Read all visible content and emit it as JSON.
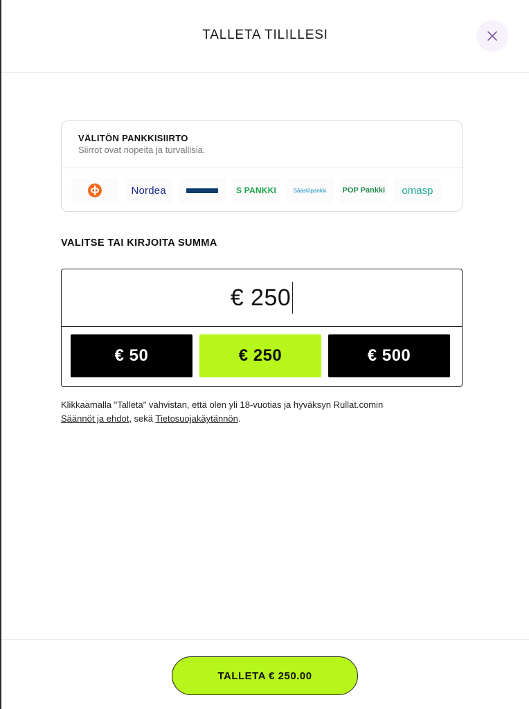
{
  "modal": {
    "title": "TALLETA TILILLESI",
    "close_icon": "close-icon"
  },
  "bank_transfer": {
    "title": "VÄLITÖN PANKKISIIRTO",
    "subtitle": "Siirrot ovat nopeita ja turvallisia.",
    "banks": [
      {
        "name": "OP",
        "icon": "op-logo"
      },
      {
        "name": "Nordea",
        "label": "Nordea"
      },
      {
        "name": "Danske Bank",
        "label": "Danske Bank"
      },
      {
        "name": "S-Pankki",
        "label": "S PANKKI"
      },
      {
        "name": "Säästöpankki",
        "label": "Säästöpankki"
      },
      {
        "name": "POP Pankki",
        "label": "POP Pankki"
      },
      {
        "name": "OmaSP",
        "label": "omasp"
      }
    ]
  },
  "amount": {
    "label": "VALITSE TAI KIRJOITA SUMMA",
    "value": "€ 250",
    "presets": [
      "€ 50",
      "€ 250",
      "€ 500"
    ],
    "selected_index": 1
  },
  "terms": {
    "text": "Klikkaamalla \"Talleta\" vahvistan, että olen yli 18-vuotias ja hyväksyn Rullat.comin",
    "link_rules": "Säännöt ja ehdot",
    "separator": ", sekä ",
    "link_privacy": "Tietosuojakäytännön",
    "end": "."
  },
  "footer": {
    "deposit_label": "TALLETA € 250.00"
  },
  "colors": {
    "accent": "#b6f61a",
    "preset_bg": "#000000",
    "close_bg": "#f6f1fb"
  }
}
